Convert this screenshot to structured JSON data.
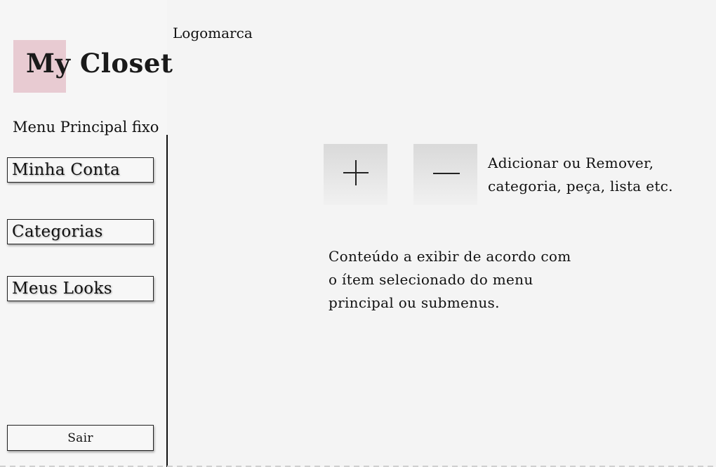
{
  "logo": {
    "text": "My Closet",
    "caption": "Logomarca",
    "highlight_color": "#e8cbd2"
  },
  "sidebar": {
    "caption": "Menu Principal fixo",
    "items": [
      {
        "label": "Minha Conta"
      },
      {
        "label": "Categorias"
      },
      {
        "label": "Meus Looks"
      }
    ],
    "logout_label": "Sair"
  },
  "toolbar": {
    "add_icon": "plus-icon",
    "remove_icon": "minus-icon",
    "description_lines": [
      "Adicionar ou Remover,",
      "categoria, peça, lista etc."
    ]
  },
  "main": {
    "content_lines": [
      "Conteúdo a exibir de acordo com",
      "o ítem selecionado do menu",
      "principal ou submenus."
    ]
  }
}
